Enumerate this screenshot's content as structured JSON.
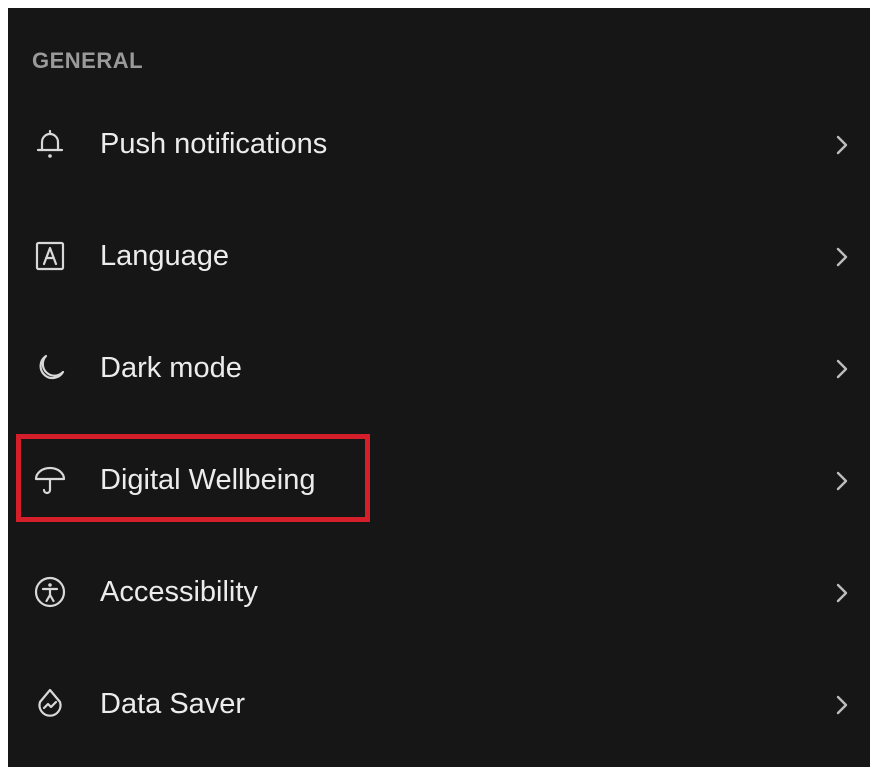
{
  "section": {
    "title": "GENERAL"
  },
  "items": [
    {
      "label": "Push notifications",
      "icon": "bell-icon"
    },
    {
      "label": "Language",
      "icon": "language-a-icon"
    },
    {
      "label": "Dark mode",
      "icon": "moon-icon"
    },
    {
      "label": "Digital Wellbeing",
      "icon": "umbrella-icon"
    },
    {
      "label": "Accessibility",
      "icon": "accessibility-icon"
    },
    {
      "label": "Data Saver",
      "icon": "data-saver-icon"
    }
  ],
  "colors": {
    "background": "#161616",
    "text": "#ececec",
    "section_header": "#9a9a9a",
    "highlight": "#d41f2a"
  }
}
